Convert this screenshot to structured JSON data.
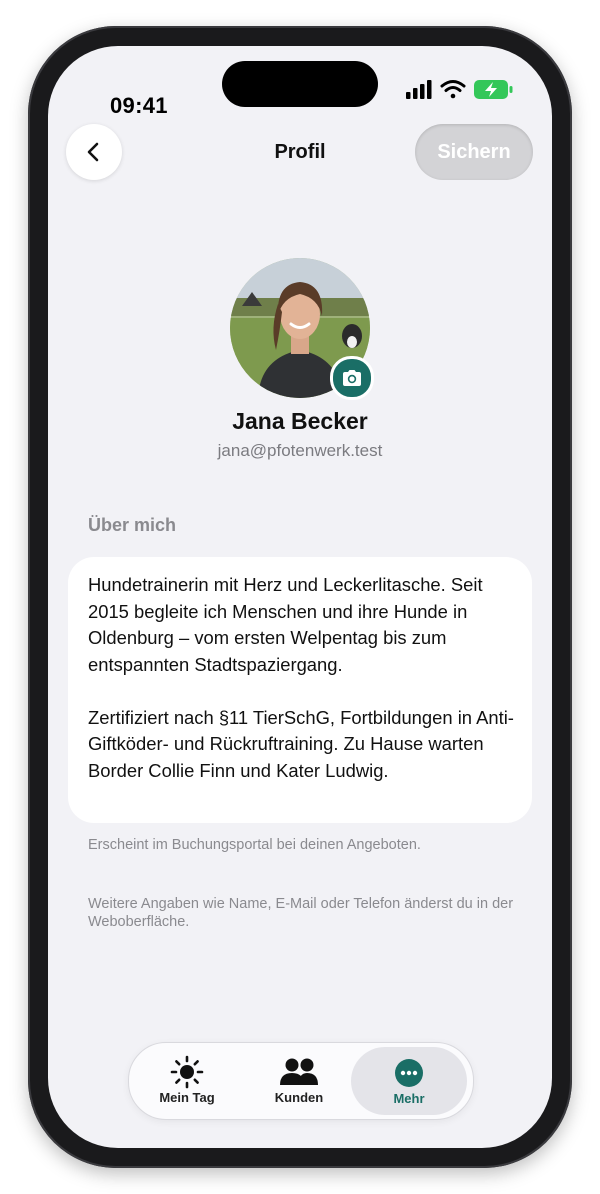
{
  "status": {
    "time": "09:41"
  },
  "nav": {
    "title": "Profil",
    "save_label": "Sichern",
    "back_icon": "chevron-left-icon"
  },
  "profile": {
    "name": "Jana Becker",
    "email": "jana@pfotenwerk.test",
    "camera_icon": "camera-icon"
  },
  "about": {
    "label": "Über mich",
    "text": "Hundetrainerin mit Herz und Leckerlitasche. Seit 2015 begleite ich Menschen und ihre Hunde in Oldenburg – vom ersten Welpentag bis zum entspannten Stadtspaziergang.\n\nZertifiziert nach §11 TierSchG, Fortbildungen in Anti-Giftköder- und Rückruftraining. Zu Hause warten Border Collie Finn und Kater Ludwig.",
    "hint": "Erscheint im Buchungsportal bei deinen Angeboten."
  },
  "footer_note": "Weitere Angaben wie Name, E-Mail oder Telefon änderst du in der Weboberfläche.",
  "tabbar": {
    "items": [
      {
        "label": "Mein Tag",
        "icon": "sun-icon"
      },
      {
        "label": "Kunden",
        "icon": "people-icon"
      },
      {
        "label": "Mehr",
        "icon": "more-icon",
        "active": true
      }
    ]
  },
  "colors": {
    "accent": "#1a6e66",
    "background": "#f2f2f6",
    "card": "#ffffff",
    "muted": "#8a8a8f"
  }
}
